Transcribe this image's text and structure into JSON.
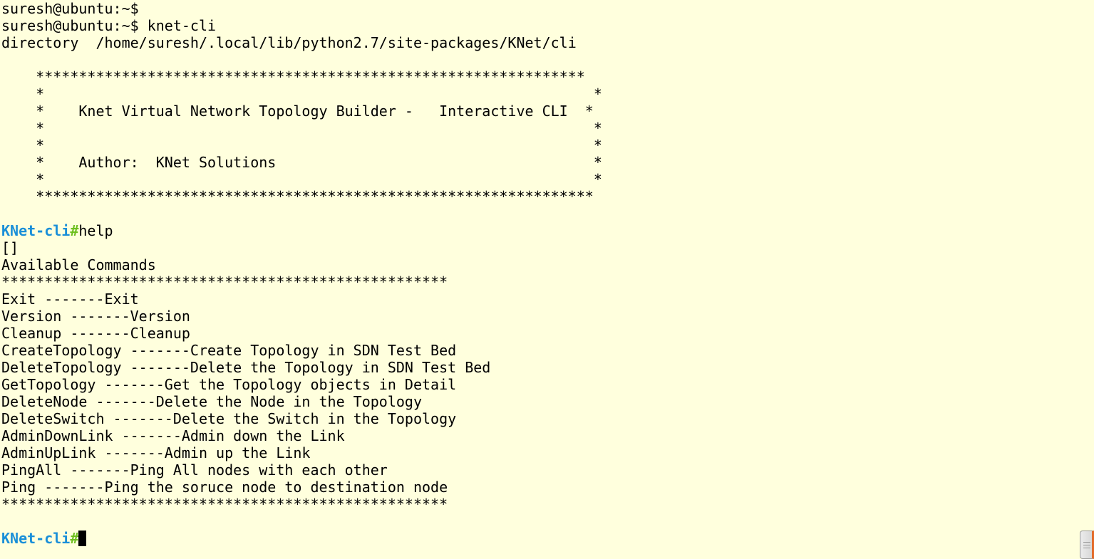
{
  "colors": {
    "background": "#ffffdd",
    "text": "#000000",
    "prompt_name": "#1a8fd8",
    "prompt_hash": "#6dbf1e",
    "scroll_accent": "#e36b2a"
  },
  "shell": {
    "line1": "suresh@ubuntu:~$",
    "line2": "suresh@ubuntu:~$ knet-cli",
    "directory_line": "directory  /home/suresh/.local/lib/python2.7/site-packages/KNet/cli"
  },
  "banner": {
    "top_border": "    ****************************************************************",
    "row1": "    *                                                                *",
    "title_row": "    *    Knet Virtual Network Topology Builder -   Interactive CLI  *",
    "row3": "    *                                                                *",
    "row4": "    *                                                                *",
    "author_row": "    *    Author:  KNet Solutions                                     *",
    "row6": "    *                                                                *",
    "bottom_border": "    *****************************************************************"
  },
  "cli": {
    "prompt_name": "KNet-cli",
    "prompt_hash": "#",
    "first_command": "help",
    "empty_list": "[]",
    "available_heading": "Available Commands",
    "separator": "****************************************************",
    "commands": [
      "Exit -------Exit",
      "Version -------Version",
      "Cleanup -------Cleanup",
      "CreateTopology -------Create Topology in SDN Test Bed",
      "DeleteTopology -------Delete the Topology in SDN Test Bed",
      "GetTopology -------Get the Topology objects in Detail",
      "DeleteNode -------Delete the Node in the Topology",
      "DeleteSwitch -------Delete the Switch in the Topology",
      "AdminDownLink -------Admin down the Link",
      "AdminUpLink -------Admin up the Link",
      "PingAll -------Ping All nodes with each other",
      "Ping -------Ping the soruce node to destination node"
    ]
  }
}
